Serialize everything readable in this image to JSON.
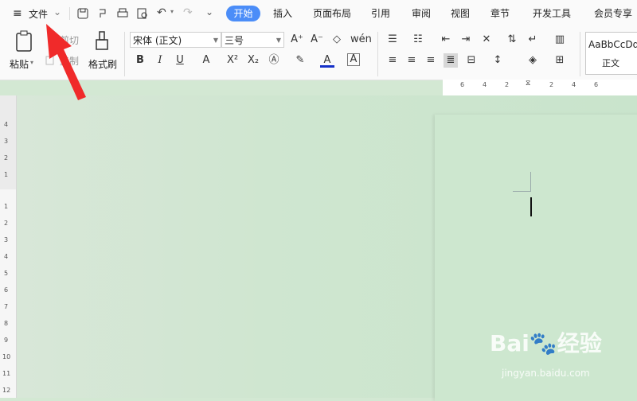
{
  "menubar": {
    "file_label": "文件",
    "tabs": [
      "插入",
      "页面布局",
      "引用",
      "审阅",
      "视图",
      "章节",
      "开发工具",
      "会员专享"
    ],
    "active_tab": "开始"
  },
  "ribbon": {
    "paste_label": "粘贴",
    "cut_label": "剪切",
    "copy_label": "复制",
    "format_painter_label": "格式刷",
    "font_name": "宋体 (正文)",
    "font_size": "三号",
    "style_preview": "AaBbCcDd",
    "style_name": "正文"
  },
  "hruler": {
    "labels": [
      "6",
      "4",
      "2",
      "2",
      "4",
      "6"
    ]
  },
  "vruler": {
    "labels": [
      "4",
      "3",
      "2",
      "1",
      "1",
      "2",
      "3",
      "4",
      "5",
      "6",
      "7",
      "8",
      "9",
      "10",
      "11",
      "12"
    ]
  },
  "watermark": {
    "brand": "Bai",
    "brand2": "经验",
    "url": "jingyan.baidu.com"
  },
  "colors": {
    "accent": "#4b8df8",
    "arrow": "#f02a2a",
    "page_bg": "#cde7cf"
  }
}
